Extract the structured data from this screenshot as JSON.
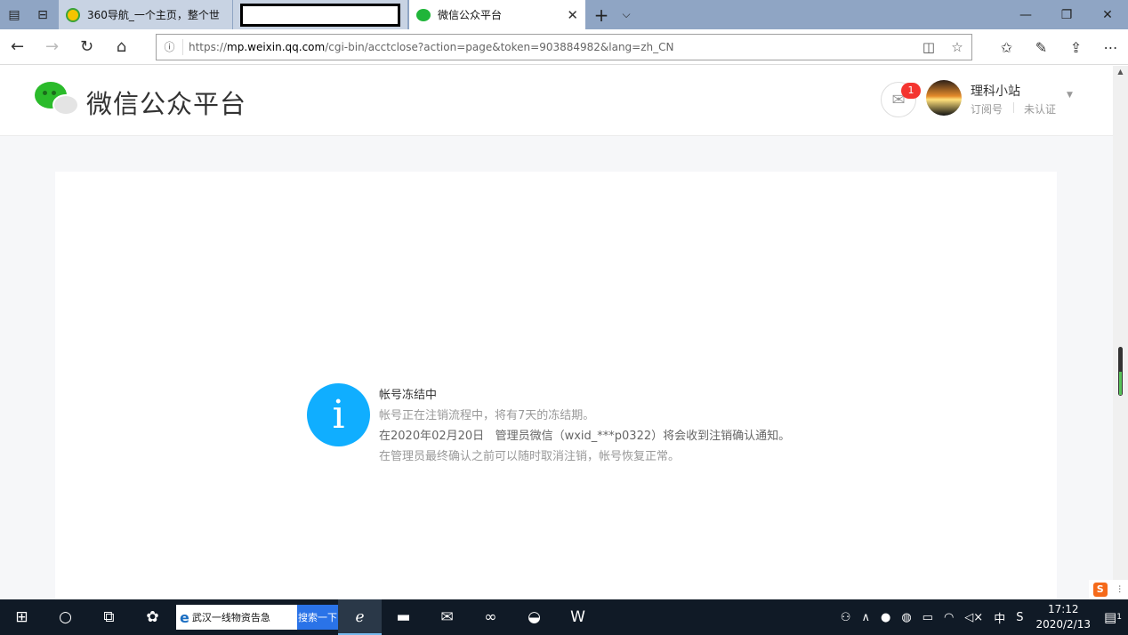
{
  "browser": {
    "tabs": [
      {
        "title": "360导航_一个主页，整个世"
      },
      {
        "title": ""
      },
      {
        "title": "微信公众平台",
        "active": true
      }
    ],
    "url_prefix": "https://",
    "url_host": "mp.weixin.qq.com",
    "url_path": "/cgi-bin/acctclose?action=page&token=903884982&lang=zh_CN"
  },
  "header": {
    "site_title": "微信公众平台",
    "unread_count": "1",
    "account_name": "理科小站",
    "account_type": "订阅号",
    "account_status": "未认证"
  },
  "notice": {
    "icon_glyph": "i",
    "title": "帐号冻结中",
    "line1": "帐号正在注销流程中，将有7天的冻结期。",
    "line2_prefix": "在",
    "line2_date": "2020年02月20日",
    "line2_rest": "管理员微信（wxid_***p0322）将会收到注销确认通知。",
    "line3": "在管理员最终确认之前可以随时取消注销，帐号恢复正常。",
    "accent_color": "#10aeff"
  },
  "taskbar": {
    "search_text": "武汉一线物资告急",
    "search_button": "搜索一下",
    "ime_label": "中",
    "time": "17:12",
    "date": "2020/2/13",
    "notification_count": "1"
  }
}
